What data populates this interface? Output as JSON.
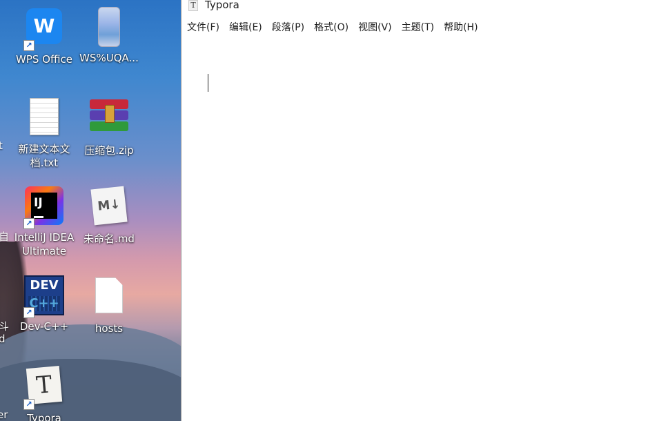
{
  "desktop": {
    "icons": [
      {
        "label": "WPS Office",
        "glyph": "W",
        "shortcut": true,
        "icon": "wps-office-icon"
      },
      {
        "label": "WS%UQA...",
        "shortcut": false,
        "icon": "image-file-icon"
      },
      {
        "label": "新建文本文档.txt",
        "shortcut": false,
        "icon": "text-file-icon"
      },
      {
        "label": "压缩包.zip",
        "shortcut": false,
        "icon": "winrar-archive-icon"
      },
      {
        "label": "IntelliJ IDEA Ultimate",
        "glyph": "IJ",
        "shortcut": true,
        "icon": "intellij-idea-icon"
      },
      {
        "label": "未命名.md",
        "glyph": "M↓",
        "shortcut": false,
        "icon": "markdown-file-icon"
      },
      {
        "label": "Dev-C++",
        "glyph": "DEV",
        "glyph2": "C++",
        "shortcut": true,
        "icon": "dev-cpp-icon"
      },
      {
        "label": "hosts",
        "shortcut": false,
        "icon": "generic-file-icon"
      },
      {
        "label": "Typora",
        "glyph": "T",
        "shortcut": true,
        "icon": "typora-icon"
      }
    ],
    "partial_labels": [
      "t",
      "自",
      "斗",
      "d",
      "er"
    ],
    "shortcut_glyph": "↗"
  },
  "window": {
    "title": "Typora",
    "app_icon_glyph": "T",
    "menu": [
      "文件(F)",
      "编辑(E)",
      "段落(P)",
      "格式(O)",
      "视图(V)",
      "主题(T)",
      "帮助(H)"
    ]
  },
  "colors": {
    "wps_blue": "#1c86f0",
    "window_bg": "#ffffff",
    "text": "#222222"
  }
}
